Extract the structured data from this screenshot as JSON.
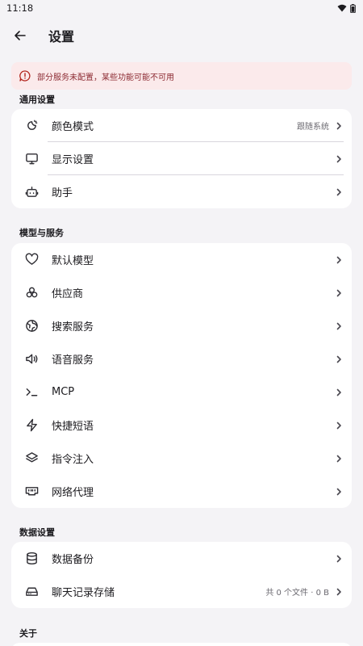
{
  "status": {
    "time": "11:18"
  },
  "header": {
    "title": "设置"
  },
  "warning": {
    "text": "部分服务未配置，某些功能可能不可用"
  },
  "sections": {
    "general": {
      "title": "通用设置",
      "items": [
        {
          "label": "颜色模式",
          "value": "跟随系统",
          "icon": "theme-icon"
        },
        {
          "label": "显示设置",
          "icon": "monitor-icon"
        },
        {
          "label": "助手",
          "icon": "bot-icon"
        }
      ]
    },
    "models": {
      "title": "模型与服务",
      "items": [
        {
          "label": "默认模型",
          "icon": "heart-icon"
        },
        {
          "label": "供应商",
          "icon": "boxes-icon"
        },
        {
          "label": "搜索服务",
          "icon": "globe-icon"
        },
        {
          "label": "语音服务",
          "icon": "speaker-icon"
        },
        {
          "label": "MCP",
          "icon": "terminal-icon"
        },
        {
          "label": "快捷短语",
          "icon": "zap-icon"
        },
        {
          "label": "指令注入",
          "icon": "layers-icon"
        },
        {
          "label": "网络代理",
          "icon": "network-icon"
        }
      ]
    },
    "data": {
      "title": "数据设置",
      "items": [
        {
          "label": "数据备份",
          "icon": "database-icon"
        },
        {
          "label": "聊天记录存储",
          "value": "共 0 个文件 · 0 B",
          "icon": "drive-icon"
        }
      ]
    },
    "about": {
      "title": "关于"
    }
  }
}
